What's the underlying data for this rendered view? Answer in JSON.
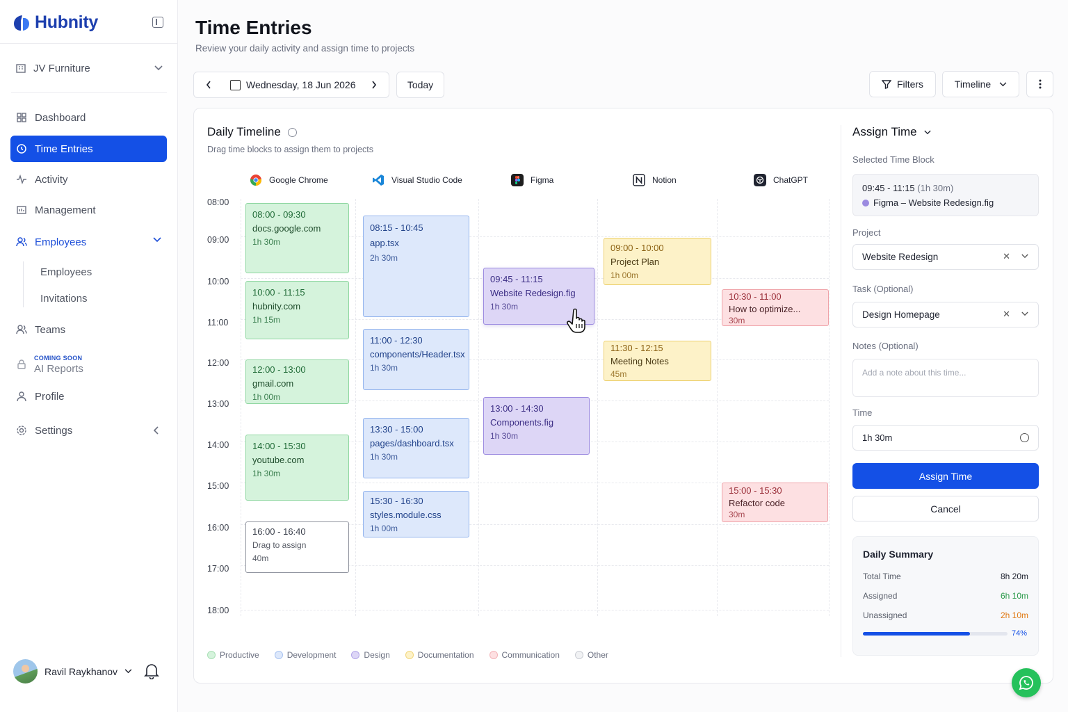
{
  "app": {
    "name": "Hubnity"
  },
  "sidebar": {
    "org": "JV Furniture",
    "items": [
      {
        "label": "Dashboard"
      },
      {
        "label": "Time Entries"
      },
      {
        "label": "Activity"
      },
      {
        "label": "Management"
      },
      {
        "label": "Employees"
      },
      {
        "label": "Teams"
      },
      {
        "label": "AI Reports",
        "badge": "COMING SOON"
      },
      {
        "label": "Profile"
      },
      {
        "label": "Settings"
      }
    ],
    "sub_items": [
      "Employees",
      "Invitations"
    ],
    "user": "Ravil Raykhanov"
  },
  "header": {
    "title": "Time Entries",
    "subtitle": "Review your daily activity and assign time to projects",
    "date": "Wednesday, 18 Jun 2026",
    "today": "Today",
    "filters": "Filters",
    "view": "Timeline"
  },
  "timeline": {
    "title": "Daily Timeline",
    "subtitle": "Drag time blocks to assign them to projects",
    "apps": [
      "Google Chrome",
      "Visual Studio Code",
      "Figma",
      "Notion",
      "ChatGPT"
    ],
    "hours": [
      "08:00",
      "09:00",
      "10:00",
      "11:00",
      "12:00",
      "13:00",
      "14:00",
      "15:00",
      "16:00",
      "17:00",
      "18:00"
    ],
    "blocks": [
      {
        "time": "08:00 - 09:30",
        "name": "docs.google.com",
        "dur": "1h 30m",
        "cat": "Productive"
      },
      {
        "time": "10:00 - 11:15",
        "name": "hubnity.com",
        "dur": "1h 15m",
        "cat": "Productive"
      },
      {
        "time": "12:00 - 13:00",
        "name": "gmail.com",
        "dur": "1h 00m",
        "cat": "Productive"
      },
      {
        "time": "14:00 - 15:30",
        "name": "youtube.com",
        "dur": "1h 30m",
        "cat": "Productive"
      },
      {
        "time": "16:00 - 16:40",
        "name": "Drag to assign",
        "dur": "40m",
        "cat": "Other"
      },
      {
        "time": "08:15 - 10:45",
        "name": "app.tsx",
        "dur": "2h 30m",
        "cat": "Development"
      },
      {
        "time": "11:00 - 12:30",
        "name": "components/Header.tsx",
        "dur": "1h 30m",
        "cat": "Development"
      },
      {
        "time": "13:30 - 15:00",
        "name": "pages/dashboard.tsx",
        "dur": "1h 30m",
        "cat": "Development"
      },
      {
        "time": "15:30 - 16:30",
        "name": "styles.module.css",
        "dur": "1h 00m",
        "cat": "Development"
      },
      {
        "time": "09:45 - 11:15",
        "name": "Website Redesign.fig",
        "dur": "1h 30m",
        "cat": "Design"
      },
      {
        "time": "13:00 - 14:30",
        "name": "Components.fig",
        "dur": "1h 30m",
        "cat": "Design"
      },
      {
        "time": "09:00 - 10:00",
        "name": "Project Plan",
        "dur": "1h 00m",
        "cat": "Documentation"
      },
      {
        "time": "11:30 - 12:15",
        "name": "Meeting Notes",
        "dur": "45m",
        "cat": "Documentation"
      },
      {
        "time": "10:30 - 11:00",
        "name": "How to optimize...",
        "dur": "30m",
        "cat": "Communication"
      },
      {
        "time": "15:00 - 15:30",
        "name": "Refactor code",
        "dur": "30m",
        "cat": "Communication"
      }
    ],
    "legend": [
      "Productive",
      "Development",
      "Design",
      "Documentation",
      "Communication",
      "Other"
    ]
  },
  "assign": {
    "title": "Assign Time",
    "selected_label": "Selected Time Block",
    "selected_time": "09:45 - 11:15",
    "selected_dur": "(1h 30m)",
    "selected_name": "Figma – Website Redesign.fig",
    "project_label": "Project",
    "project": "Website Redesign",
    "task_label": "Task (Optional)",
    "task": "Design Homepage",
    "notes_label": "Notes (Optional)",
    "notes_placeholder": "Add a note about this time...",
    "time_label": "Time",
    "time": "1h 30m",
    "assign_btn": "Assign Time",
    "cancel_btn": "Cancel"
  },
  "summary": {
    "title": "Daily Summary",
    "total_label": "Total Time",
    "total": "8h 20m",
    "assigned_label": "Assigned",
    "assigned": "6h 10m",
    "unassigned_label": "Unassigned",
    "unassigned": "2h 10m",
    "percent": "74%",
    "percent_value": 0.74
  },
  "colors": {
    "accent": "#1450e6",
    "productive": "#d5f3dc",
    "development": "#dde8fb",
    "design": "#ddd6f6",
    "documentation": "#fdf2c8",
    "communication": "#fde0e2"
  }
}
